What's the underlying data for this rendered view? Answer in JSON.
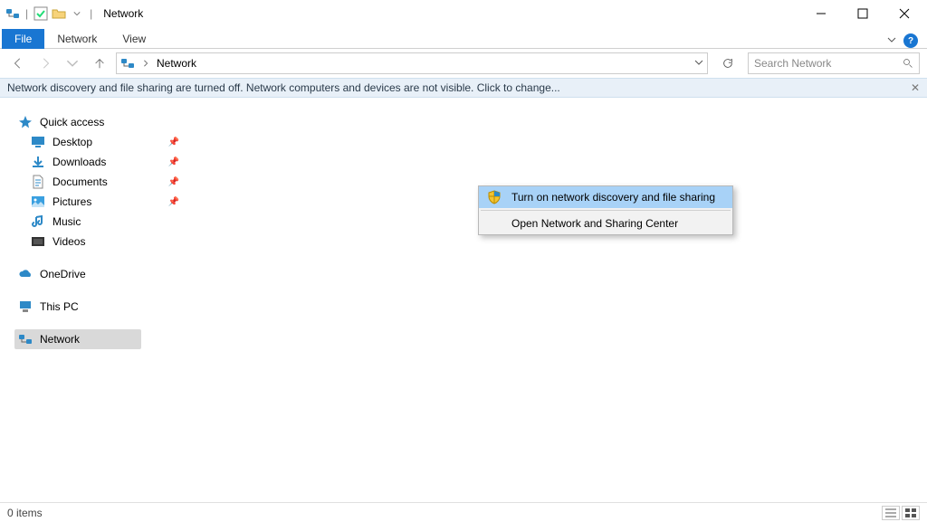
{
  "window": {
    "title": "Network"
  },
  "ribbon": {
    "file": "File",
    "tabs": [
      "Network",
      "View"
    ]
  },
  "nav": {
    "address": "Network",
    "search_placeholder": "Search Network"
  },
  "infobar": {
    "text": "Network discovery and file sharing are turned off. Network computers and devices are not visible. Click to change..."
  },
  "context_menu": {
    "items": [
      {
        "label": "Turn on network discovery and file sharing",
        "highlighted": true,
        "shield": true
      },
      {
        "label": "Open Network and Sharing Center",
        "highlighted": false,
        "shield": false
      }
    ]
  },
  "sidebar": {
    "quick_access": "Quick access",
    "items": [
      {
        "label": "Desktop",
        "icon": "desktop",
        "pinned": true
      },
      {
        "label": "Downloads",
        "icon": "download",
        "pinned": true
      },
      {
        "label": "Documents",
        "icon": "document",
        "pinned": true
      },
      {
        "label": "Pictures",
        "icon": "pictures",
        "pinned": true
      },
      {
        "label": "Music",
        "icon": "music",
        "pinned": false
      },
      {
        "label": "Videos",
        "icon": "videos",
        "pinned": false
      }
    ],
    "onedrive": "OneDrive",
    "thispc": "This PC",
    "network": "Network"
  },
  "status": {
    "items": "0 items"
  }
}
